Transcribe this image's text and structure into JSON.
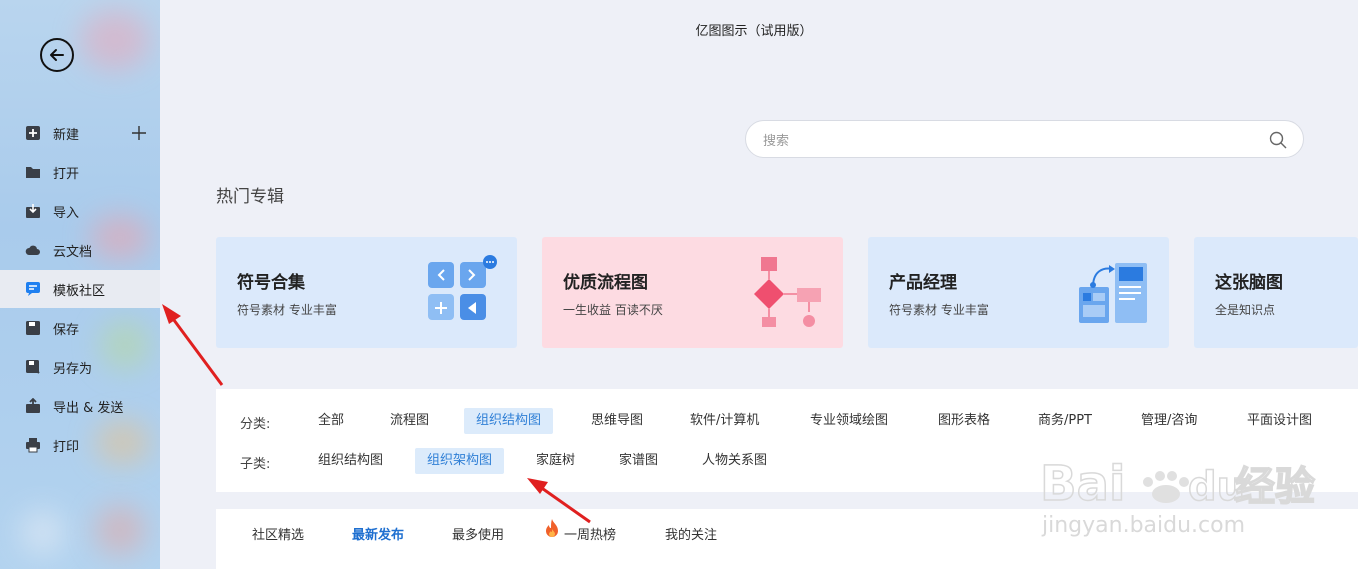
{
  "app": {
    "title": "亿图图示（试用版）"
  },
  "sidebar": {
    "items": [
      {
        "label": "新建",
        "icon": "plus-square-icon"
      },
      {
        "label": "打开",
        "icon": "folder-icon"
      },
      {
        "label": "导入",
        "icon": "import-icon"
      },
      {
        "label": "云文档",
        "icon": "cloud-icon"
      },
      {
        "label": "模板社区",
        "icon": "community-icon",
        "active": true
      },
      {
        "label": "保存",
        "icon": "save-icon"
      },
      {
        "label": "另存为",
        "icon": "save-as-icon"
      },
      {
        "label": "导出 & 发送",
        "icon": "export-icon"
      },
      {
        "label": "打印",
        "icon": "printer-icon"
      }
    ]
  },
  "search": {
    "placeholder": "搜索"
  },
  "hot": {
    "title": "热门专辑",
    "cards": [
      {
        "title": "符号合集",
        "subtitle": "符号素材 专业丰富",
        "bg": "#dbe9fb"
      },
      {
        "title": "优质流程图",
        "subtitle": "一生收益 百读不厌",
        "bg": "#fddbe2"
      },
      {
        "title": "产品经理",
        "subtitle": "符号素材 专业丰富",
        "bg": "#dbe9fb"
      },
      {
        "title": "这张脑图",
        "subtitle": "全是知识点",
        "bg": "#dbe9fb"
      }
    ]
  },
  "filters": {
    "category_label": "分类:",
    "categories": [
      "全部",
      "流程图",
      "组织结构图",
      "思维导图",
      "软件/计算机",
      "专业领域绘图",
      "图形表格",
      "商务/PPT",
      "管理/咨询",
      "平面设计图"
    ],
    "category_selected": "组织结构图",
    "sub_label": "子类:",
    "subcategories": [
      "组织结构图",
      "组织架构图",
      "家庭树",
      "家谱图",
      "人物关系图"
    ],
    "sub_selected": "组织架构图"
  },
  "tabs": {
    "items": [
      "社区精选",
      "最新发布",
      "最多使用",
      "一周热榜",
      "我的关注"
    ],
    "selected": "最新发布"
  },
  "watermark": {
    "brand": "Bai",
    "brand2": "du",
    "cn": "经验",
    "url": "jingyan.baidu.com"
  },
  "colors": {
    "accent": "#2f7fd6",
    "arrow": "#e02020"
  }
}
